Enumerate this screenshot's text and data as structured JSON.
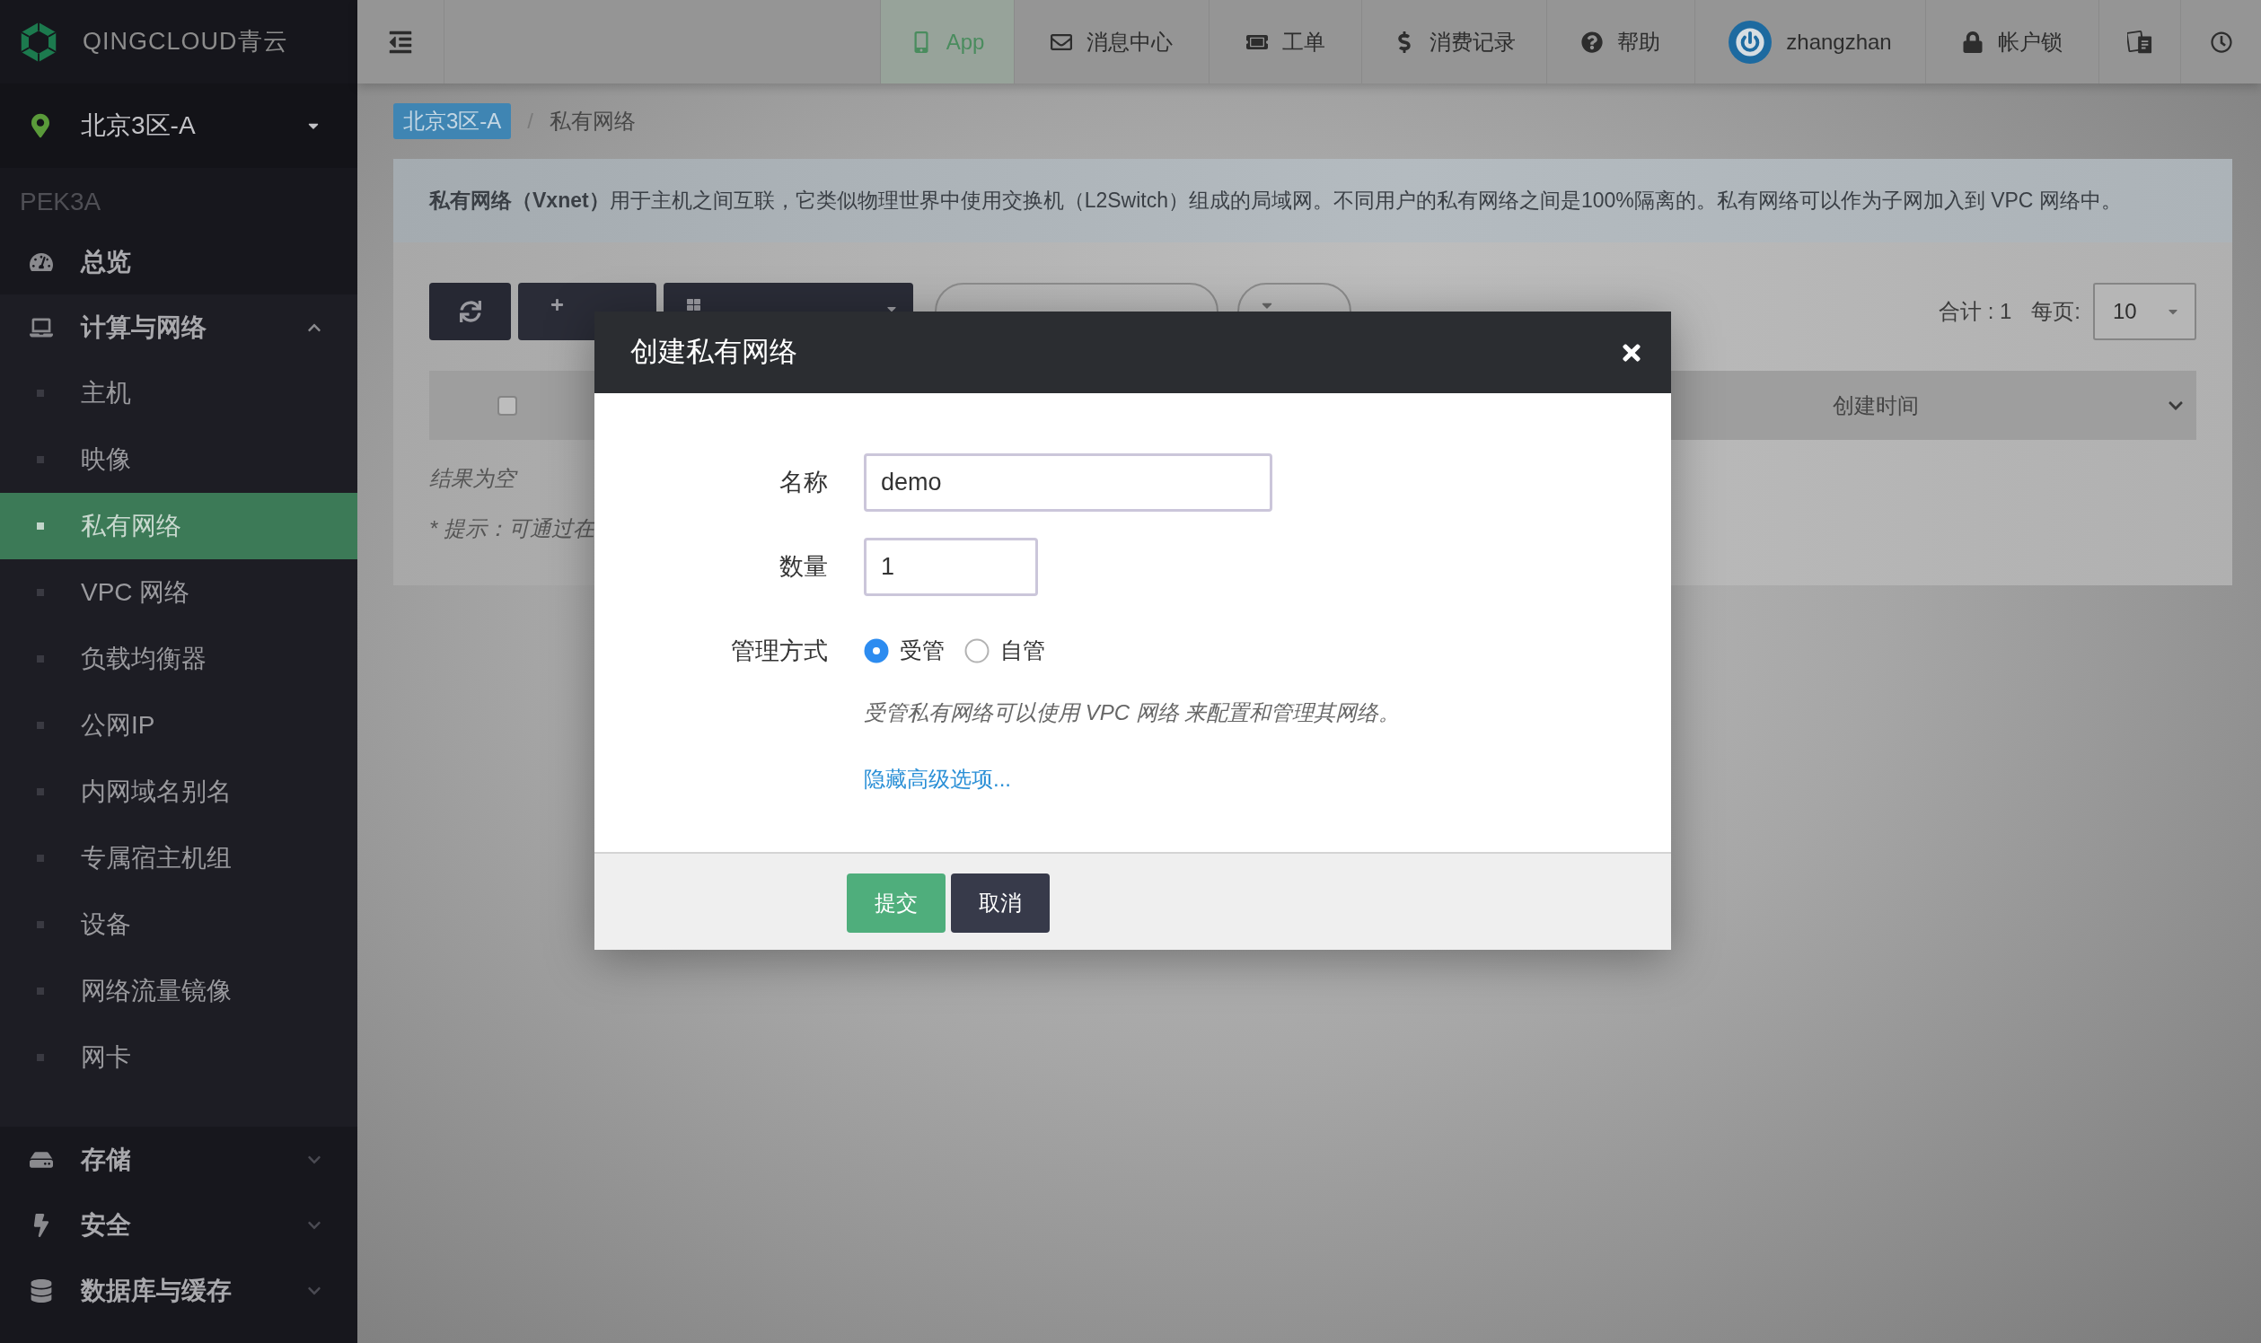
{
  "logo": "QINGCLOUD青云",
  "header": {
    "nav": [
      {
        "label": "App",
        "selected": true
      },
      {
        "label": "消息中心",
        "selected": false
      },
      {
        "label": "工单",
        "selected": false
      },
      {
        "label": "消费记录",
        "selected": false
      },
      {
        "label": "帮助",
        "selected": false
      },
      {
        "label": "zhangzhan",
        "selected": false
      },
      {
        "label": "帐户锁",
        "selected": false
      }
    ]
  },
  "sidebar": {
    "zone": "北京3区-A",
    "zone_code": "PEK3A",
    "items": [
      {
        "label": "总览",
        "kind": "link"
      },
      {
        "label": "计算与网络",
        "kind": "group",
        "expanded": true,
        "children": [
          {
            "label": "主机",
            "selected": false
          },
          {
            "label": "映像",
            "selected": false
          },
          {
            "label": "私有网络",
            "selected": true
          },
          {
            "label": "VPC 网络",
            "selected": false
          },
          {
            "label": "负载均衡器",
            "selected": false
          },
          {
            "label": "公网IP",
            "selected": false
          },
          {
            "label": "内网域名别名",
            "selected": false
          },
          {
            "label": "专属宿主机组",
            "selected": false
          },
          {
            "label": "设备",
            "selected": false
          },
          {
            "label": "网络流量镜像",
            "selected": false
          },
          {
            "label": "网卡",
            "selected": false
          }
        ]
      },
      {
        "label": "存储",
        "kind": "group",
        "expanded": false
      },
      {
        "label": "安全",
        "kind": "group",
        "expanded": false
      },
      {
        "label": "数据库与缓存",
        "kind": "group",
        "expanded": false
      }
    ]
  },
  "breadcrumb": {
    "items": [
      "北京3区-A",
      "私有网络"
    ],
    "separator": "/"
  },
  "banner": "**私有网络（Vxnet）**用于主机之间互联，它类似物理世界中使用交换机（L2Switch）组成的局域网。不同用户的私有网络之间是100%隔离的。私有网络可以作为子网加入到 VPC 网络中。",
  "toolbar": {
    "buttons": [
      {
        "kind": "refresh"
      },
      {
        "kind": "create"
      },
      {
        "kind": "menu"
      },
      {
        "kind": "search"
      },
      {
        "kind": "tag"
      }
    ],
    "total": "合计 : 1",
    "per_page_label": "每页:",
    "per_page": "10"
  },
  "table": {
    "select_all": {
      "checked": false
    },
    "columns": [
      "创建时间"
    ],
    "empty_text": "结果为空",
    "tip": "* 提示：可通过在"
  },
  "dialog": {
    "title": "创建私有网络",
    "fields": [
      {
        "kind": "text",
        "label": "名称",
        "value": "demo"
      },
      {
        "kind": "number",
        "label": "数量",
        "value": "1"
      },
      {
        "kind": "radio",
        "label": "管理方式",
        "options": [
          {
            "label": "受管",
            "selected": true
          },
          {
            "label": "自管",
            "selected": false
          }
        ]
      }
    ],
    "note": "受管私有网络可以使用 VPC 网络 来配置和管理其网络。",
    "link": "隐藏高级选项...",
    "buttons": [
      {
        "label": "提交",
        "kind": "primary"
      },
      {
        "label": "取消",
        "kind": "secondary"
      }
    ]
  }
}
